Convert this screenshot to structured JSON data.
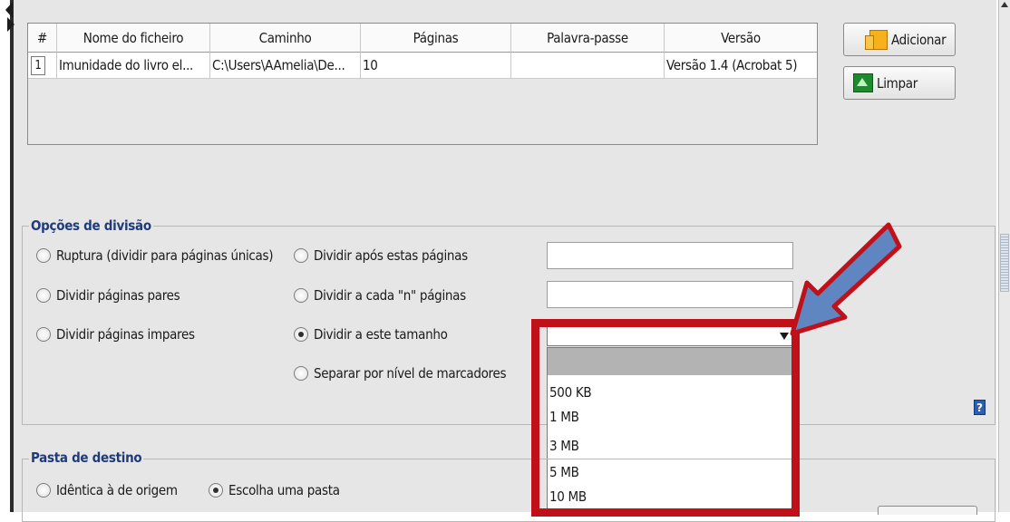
{
  "table": {
    "columns": [
      "#",
      "Nome do ficheiro",
      "Caminho",
      "Páginas",
      "Palavra-passe",
      "Versão"
    ],
    "rows": [
      {
        "index": "1",
        "name": "Imunidade do livro el...",
        "path": "C:\\Users\\AAmelia\\De...",
        "pages": "10",
        "password": "",
        "version": "Versão 1.4 (Acrobat 5)"
      }
    ]
  },
  "buttons": {
    "add": "Adicionar",
    "clear": "Limpar"
  },
  "split_options": {
    "legend": "Opções de divisão",
    "radios": {
      "burst": "Ruptura (dividir para páginas únicas)",
      "after_pages": "Dividir após estas páginas",
      "even": "Dividir páginas pares",
      "every_n": "Dividir a cada \"n\" páginas",
      "odd": "Dividir páginas impares",
      "size": "Dividir a este tamanho",
      "bookmarks": "Separar por nível de marcadores"
    },
    "selected": "size",
    "size_dropdown": {
      "value": "",
      "options": [
        "500 KB",
        "1 MB",
        "3 MB",
        "5 MB",
        "10 MB"
      ]
    },
    "help": "?"
  },
  "destination": {
    "legend": "Pasta de destino",
    "radios": {
      "same": "Idêntica à de origem",
      "choose": "Escolha uma pasta"
    },
    "selected": "choose"
  },
  "colors": {
    "highlight_box": "#c0101a",
    "pointer_arrow": "#5f86c0",
    "legend_text": "#1f3b7a"
  }
}
